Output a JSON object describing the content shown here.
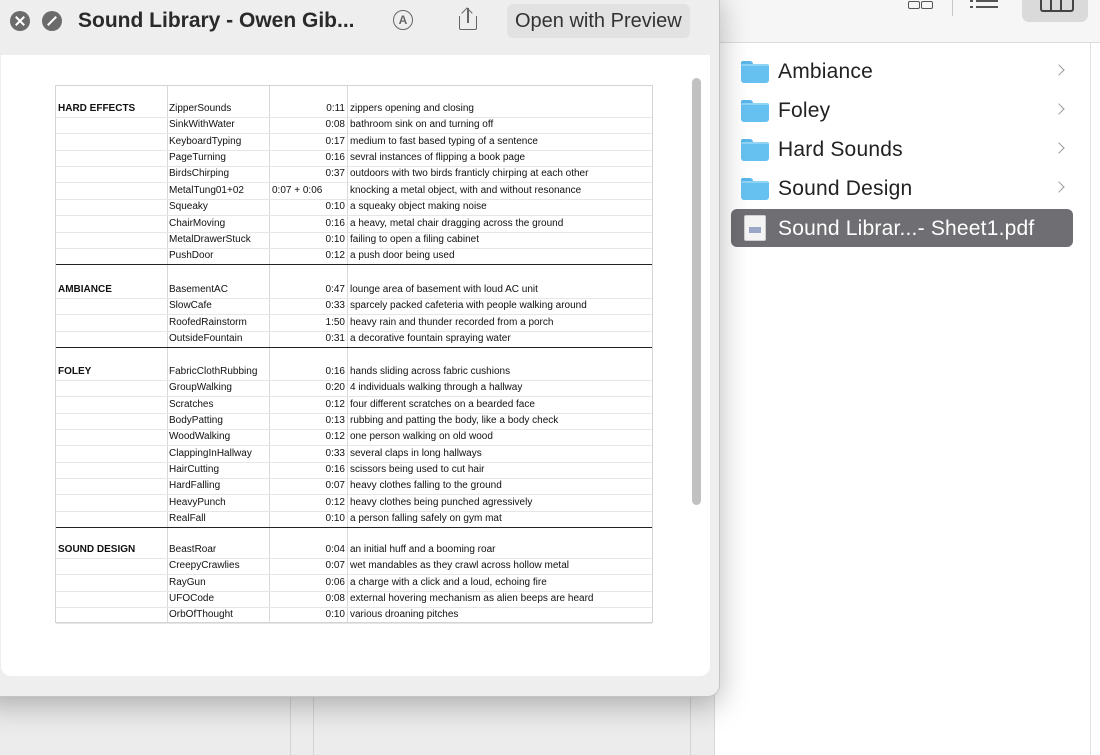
{
  "quicklook": {
    "title": "Sound Library - Owen Gib...",
    "open_with_label": "Open with Preview"
  },
  "finder": {
    "items": [
      {
        "label": "Ambiance",
        "type": "folder"
      },
      {
        "label": "Foley",
        "type": "folder"
      },
      {
        "label": "Hard Sounds",
        "type": "folder"
      },
      {
        "label": "Sound Design",
        "type": "folder"
      },
      {
        "label": "Sound Librar...- Sheet1.pdf",
        "type": "pdf",
        "selected": true
      }
    ]
  },
  "sheet": {
    "rows": [
      {
        "category": "HARD EFFECTS",
        "name": "ZipperSounds",
        "duration": "0:11",
        "description": "zippers opening and closing"
      },
      {
        "category": "",
        "name": "SinkWithWater",
        "duration": "0:08",
        "description": "bathroom sink on and turning off"
      },
      {
        "category": "",
        "name": "KeyboardTyping",
        "duration": "0:17",
        "description": "medium to fast based typing of a sentence"
      },
      {
        "category": "",
        "name": "PageTurning",
        "duration": "0:16",
        "description": "sevral instances of flipping a book page"
      },
      {
        "category": "",
        "name": "BirdsChirping",
        "duration": "0:37",
        "description": "outdoors with two birds franticly chirping at each other"
      },
      {
        "category": "",
        "name": "MetalTung01+02",
        "duration": "0:07 + 0:06",
        "description": "knocking a metal object, with and without resonance"
      },
      {
        "category": "",
        "name": "Squeaky",
        "duration": "0:10",
        "description": "a squeaky object making noise"
      },
      {
        "category": "",
        "name": "ChairMoving",
        "duration": "0:16",
        "description": "a heavy, metal chair dragging across the ground"
      },
      {
        "category": "",
        "name": "MetalDrawerStuck",
        "duration": "0:10",
        "description": "failing to open a filing cabinet"
      },
      {
        "category": "",
        "name": "PushDoor",
        "duration": "0:12",
        "description": "a push door being used"
      },
      {
        "category": "AMBIANCE",
        "name": "BasementAC",
        "duration": "0:47",
        "description": "lounge area of basement with loud AC unit"
      },
      {
        "category": "",
        "name": "SlowCafe",
        "duration": "0:33",
        "description": "sparcely packed cafeteria with people walking around"
      },
      {
        "category": "",
        "name": "RoofedRainstorm",
        "duration": "1:50",
        "description": "heavy rain and thunder recorded from a porch"
      },
      {
        "category": "",
        "name": "OutsideFountain",
        "duration": "0:31",
        "description": "a decorative fountain spraying water"
      },
      {
        "category": "FOLEY",
        "name": "FabricClothRubbing",
        "duration": "0:16",
        "description": "hands sliding across fabric cushions"
      },
      {
        "category": "",
        "name": "GroupWalking",
        "duration": "0:20",
        "description": "4 individuals walking through a hallway"
      },
      {
        "category": "",
        "name": "Scratches",
        "duration": "0:12",
        "description": "four different scratches on a bearded face"
      },
      {
        "category": "",
        "name": "BodyPatting",
        "duration": "0:13",
        "description": "rubbing and patting the body, like a body check"
      },
      {
        "category": "",
        "name": "WoodWalking",
        "duration": "0:12",
        "description": "one person walking on old wood"
      },
      {
        "category": "",
        "name": "ClappingInHallway",
        "duration": "0:33",
        "description": "several claps in long hallways"
      },
      {
        "category": "",
        "name": "HairCutting",
        "duration": "0:16",
        "description": "scissors being used to cut hair"
      },
      {
        "category": "",
        "name": "HardFalling",
        "duration": "0:07",
        "description": "heavy clothes falling to the ground"
      },
      {
        "category": "",
        "name": "HeavyPunch",
        "duration": "0:12",
        "description": "heavy clothes being punched agressively"
      },
      {
        "category": "",
        "name": "RealFall",
        "duration": "0:10",
        "description": "a person falling safely on gym mat"
      },
      {
        "category": "SOUND DESIGN",
        "name": "BeastRoar",
        "duration": "0:04",
        "description": "an initial huff and a booming roar"
      },
      {
        "category": "",
        "name": "CreepyCrawlies",
        "duration": "0:07",
        "description": "wet mandables as they crawl across hollow metal"
      },
      {
        "category": "",
        "name": "RayGun",
        "duration": "0:06",
        "description": "a charge with a click and a loud, echoing fire"
      },
      {
        "category": "",
        "name": "UFOCode",
        "duration": "0:08",
        "description": "external hovering mechanism as alien beeps are heard"
      },
      {
        "category": "",
        "name": "OrbOfThought",
        "duration": "0:10",
        "description": "various droaning pitches"
      }
    ]
  }
}
